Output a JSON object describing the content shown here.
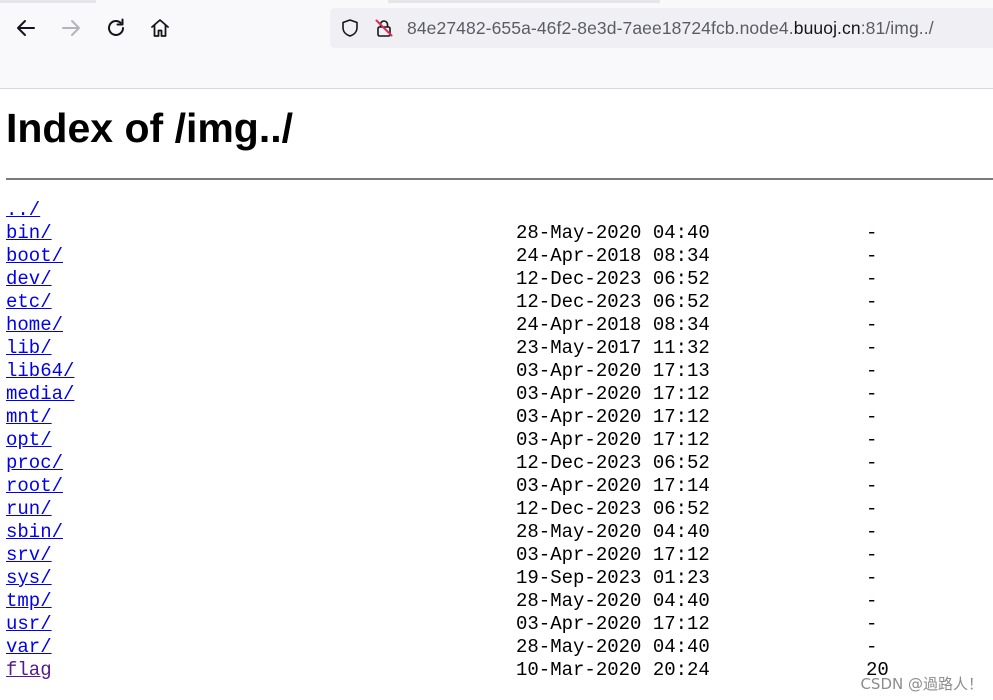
{
  "browser": {
    "address_bar": {
      "url_prefix": "84e27482-655a-46f2-8e3d-7aee18724fcb.node4.",
      "url_domain": "buuoj.cn",
      "url_suffix": ":81/img../"
    },
    "icons": [
      "back-arrow-icon",
      "forward-arrow-icon",
      "reload-icon",
      "home-icon",
      "shield-icon",
      "insecure-lock-icon"
    ],
    "colors": {
      "toolbar_bg": "#f9f9fb",
      "urlbar_bg": "#f0f0f4",
      "link": "#0000ee",
      "visited_link": "#551a8b"
    }
  },
  "page": {
    "title": "Index of /img../",
    "entries": [
      {
        "name": "../",
        "date": "",
        "size": "",
        "visited": false
      },
      {
        "name": "bin/",
        "date": "28-May-2020 04:40",
        "size": "-",
        "visited": false
      },
      {
        "name": "boot/",
        "date": "24-Apr-2018 08:34",
        "size": "-",
        "visited": false
      },
      {
        "name": "dev/",
        "date": "12-Dec-2023 06:52",
        "size": "-",
        "visited": false
      },
      {
        "name": "etc/",
        "date": "12-Dec-2023 06:52",
        "size": "-",
        "visited": false
      },
      {
        "name": "home/",
        "date": "24-Apr-2018 08:34",
        "size": "-",
        "visited": false
      },
      {
        "name": "lib/",
        "date": "23-May-2017 11:32",
        "size": "-",
        "visited": false
      },
      {
        "name": "lib64/",
        "date": "03-Apr-2020 17:13",
        "size": "-",
        "visited": false
      },
      {
        "name": "media/",
        "date": "03-Apr-2020 17:12",
        "size": "-",
        "visited": false
      },
      {
        "name": "mnt/",
        "date": "03-Apr-2020 17:12",
        "size": "-",
        "visited": false
      },
      {
        "name": "opt/",
        "date": "03-Apr-2020 17:12",
        "size": "-",
        "visited": false
      },
      {
        "name": "proc/",
        "date": "12-Dec-2023 06:52",
        "size": "-",
        "visited": false
      },
      {
        "name": "root/",
        "date": "03-Apr-2020 17:14",
        "size": "-",
        "visited": false
      },
      {
        "name": "run/",
        "date": "12-Dec-2023 06:52",
        "size": "-",
        "visited": false
      },
      {
        "name": "sbin/",
        "date": "28-May-2020 04:40",
        "size": "-",
        "visited": false
      },
      {
        "name": "srv/",
        "date": "03-Apr-2020 17:12",
        "size": "-",
        "visited": false
      },
      {
        "name": "sys/",
        "date": "19-Sep-2023 01:23",
        "size": "-",
        "visited": false
      },
      {
        "name": "tmp/",
        "date": "28-May-2020 04:40",
        "size": "-",
        "visited": false
      },
      {
        "name": "usr/",
        "date": "03-Apr-2020 17:12",
        "size": "-",
        "visited": false
      },
      {
        "name": "var/",
        "date": "28-May-2020 04:40",
        "size": "-",
        "visited": false
      },
      {
        "name": "flag",
        "date": "10-Mar-2020 20:24",
        "size": "20",
        "visited": true
      }
    ]
  },
  "watermark": "CSDN @過路人！"
}
